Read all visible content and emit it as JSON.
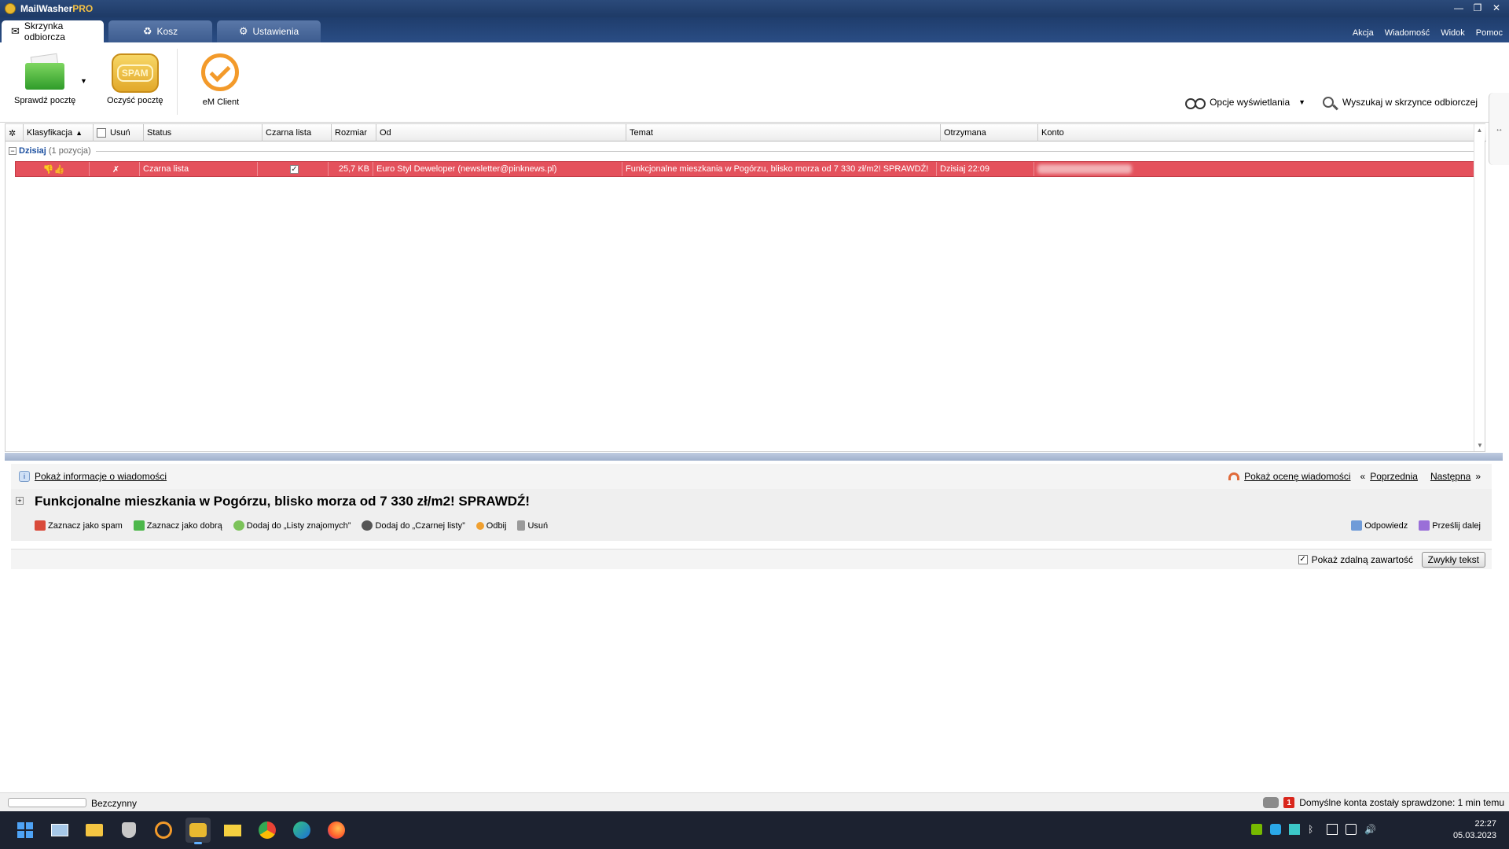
{
  "window": {
    "title_main": "MailWasher",
    "title_suffix": "PRO",
    "minimize": "—",
    "restore": "❐",
    "close": "✕"
  },
  "tabs": [
    {
      "label": "Skrzynka odbiorcza",
      "active": true
    },
    {
      "label": "Kosz",
      "active": false
    },
    {
      "label": "Ustawienia",
      "active": false
    }
  ],
  "top_menu": [
    "Akcja",
    "Wiadomość",
    "Widok",
    "Pomoc"
  ],
  "toolbar": {
    "check_mail": "Sprawdź pocztę",
    "clean_mail": "Oczyść pocztę",
    "em_client": "eM Client",
    "spam_icon_text": "SPAM",
    "display_options": "Opcje wyświetlania",
    "search_inbox": "Wyszukaj w skrzynce odbiorczej"
  },
  "grid": {
    "columns": [
      "Klasyfikacja",
      "Usuń",
      "Status",
      "Czarna lista",
      "Rozmiar",
      "Od",
      "Temat",
      "Otrzymana",
      "Konto"
    ],
    "group": {
      "title": "Dzisiaj",
      "count": "(1 pozycja)"
    },
    "rows": [
      {
        "status": "Czarna lista",
        "blacklisted": true,
        "size": "25,7 KB",
        "from": "Euro Styl Deweloper (newsletter@pinknews.pl)",
        "subject": "Funkcjonalne mieszkania w Pogórzu, blisko morza od 7 330 zł/m2! SPRAWDŹ!",
        "received": "Dzisiaj 22:09"
      }
    ]
  },
  "preview": {
    "show_info": "Pokaż informacje o wiadomości",
    "show_rating": "Pokaż ocenę wiadomości",
    "prev": "Poprzednia",
    "next": "Następna",
    "subject": "Funkcjonalne mieszkania w Pogórzu, blisko morza od 7 330 zł/m2! SPRAWDŹ!",
    "actions": [
      "Zaznacz jako spam",
      "Zaznacz jako dobrą",
      "Dodaj do „Listy znajomych”",
      "Dodaj do „Czarnej listy”",
      "Odbij",
      "Usuń"
    ],
    "right_actions": [
      "Odpowiedz",
      "Prześlij dalej"
    ],
    "show_remote": "Pokaż zdalną zawartość",
    "plain_text": "Zwykły tekst"
  },
  "status": {
    "idle": "Bezczynny",
    "badge": "1",
    "message": "Domyślne konta zostały sprawdzone: 1 min temu"
  },
  "taskbar": {
    "time": "22:27",
    "date": "05.03.2023"
  }
}
